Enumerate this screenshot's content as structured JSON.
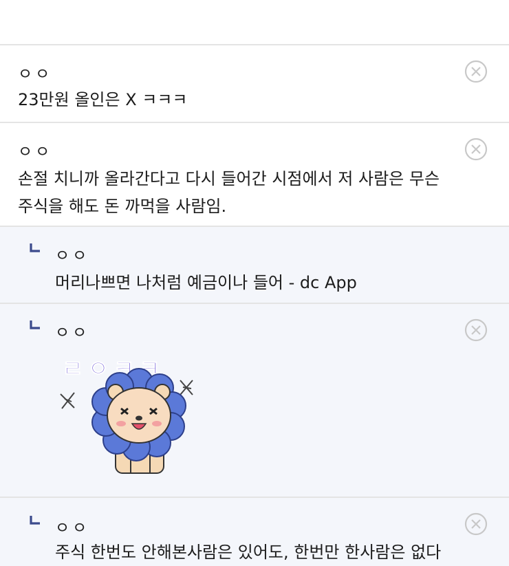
{
  "comments": [
    {
      "nick": "ㅇㅇ",
      "text": "23만원 올인은 X ㅋㅋㅋ",
      "deletable": true
    },
    {
      "nick": "ㅇㅇ",
      "text_lines": [
        "손절 치니까 올라간다고 다시 들어간 시점에서 저 사람은 무슨",
        "주식을 해도 돈 까먹을 사람임."
      ],
      "deletable": true
    },
    {
      "nick": "ㅇㅇ",
      "text": "머리나쁘면 나처럼 예금이나 들어 - dc App",
      "reply": true,
      "deletable": false
    },
    {
      "nick": "ㅇㅇ",
      "reply": true,
      "deletable": true,
      "sticker": {
        "caption": "ㄹㅇㅋㅋ",
        "description": "blue flower lion sticker"
      }
    },
    {
      "nick": "ㅇㅇ",
      "text": "주식 한번도 안해본사람은 있어도, 한번만 한사람은 없다",
      "reply": true,
      "deletable": true
    }
  ],
  "colors": {
    "divider": "#e4e4e4",
    "reply_bg": "#f4f6fb",
    "reply_mark": "#3b4a8c",
    "sticker_text": "#6a56d6",
    "flower": "#5b79d8"
  },
  "icons": {
    "delete": "close-circle-icon",
    "reply": "reply-arrow-icon"
  }
}
